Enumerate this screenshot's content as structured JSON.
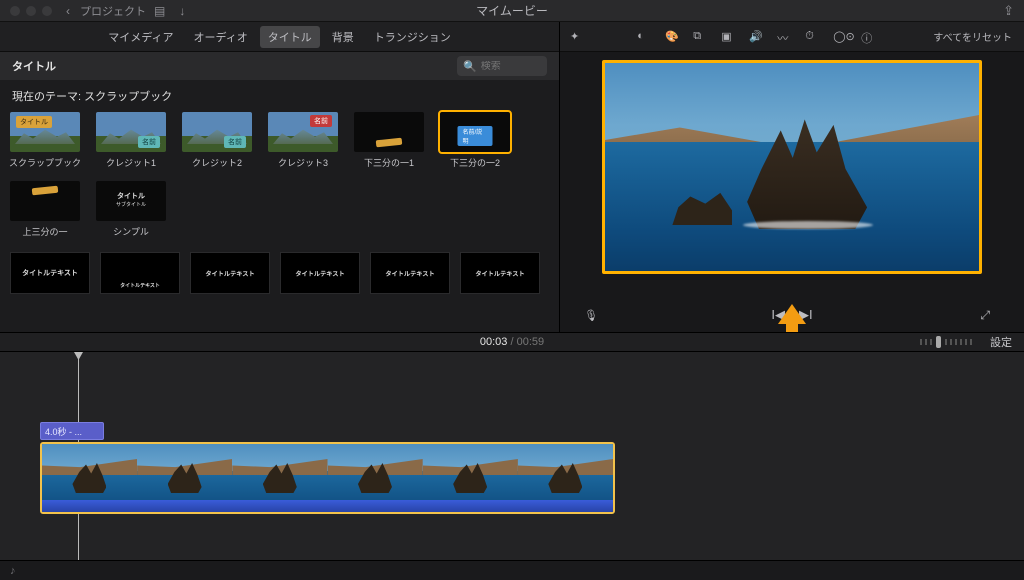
{
  "topbar": {
    "back_label": "プロジェクト",
    "app_title": "マイムービー"
  },
  "tabs": {
    "my_media": "マイメディア",
    "audio": "オーディオ",
    "titles": "タイトル",
    "background": "背景",
    "transition": "トランジション"
  },
  "titles_panel": {
    "header": "タイトル",
    "search_placeholder": "検索",
    "theme_line": "現在のテーマ: スクラップブック",
    "thumbs": [
      {
        "cap": "スクラップブック",
        "tag": "タイトル",
        "variant": "photo-orange"
      },
      {
        "cap": "クレジット1",
        "tag": "名前",
        "variant": "photo-teal"
      },
      {
        "cap": "クレジット2",
        "tag": "名前",
        "variant": "photo-teal"
      },
      {
        "cap": "クレジット3",
        "tag": "名前",
        "variant": "photo-red"
      },
      {
        "cap": "下三分の一1",
        "tag": "",
        "variant": "dark-orange"
      },
      {
        "cap": "下三分の一2",
        "tag": "名前/説明",
        "variant": "dark-bluebar",
        "selected": true
      },
      {
        "cap": "上三分の一",
        "tag": "",
        "variant": "dark-orange-top"
      },
      {
        "cap": "シンプル",
        "tag": "タイトル",
        "sub": "サブタイトル",
        "variant": "dark-center"
      }
    ],
    "strip": [
      "タイトルテキスト",
      "タイトルテキスト",
      "タイトルテキスト",
      "タイトルテキスト",
      "タイトルテキスト",
      "タイトルテキスト"
    ]
  },
  "right_toolbar": {
    "reset": "すべてをリセット"
  },
  "time": {
    "current": "00:03",
    "total": "00:59",
    "settings": "設定"
  },
  "timeline": {
    "title_clip_label": "4.0秒 - ..."
  }
}
